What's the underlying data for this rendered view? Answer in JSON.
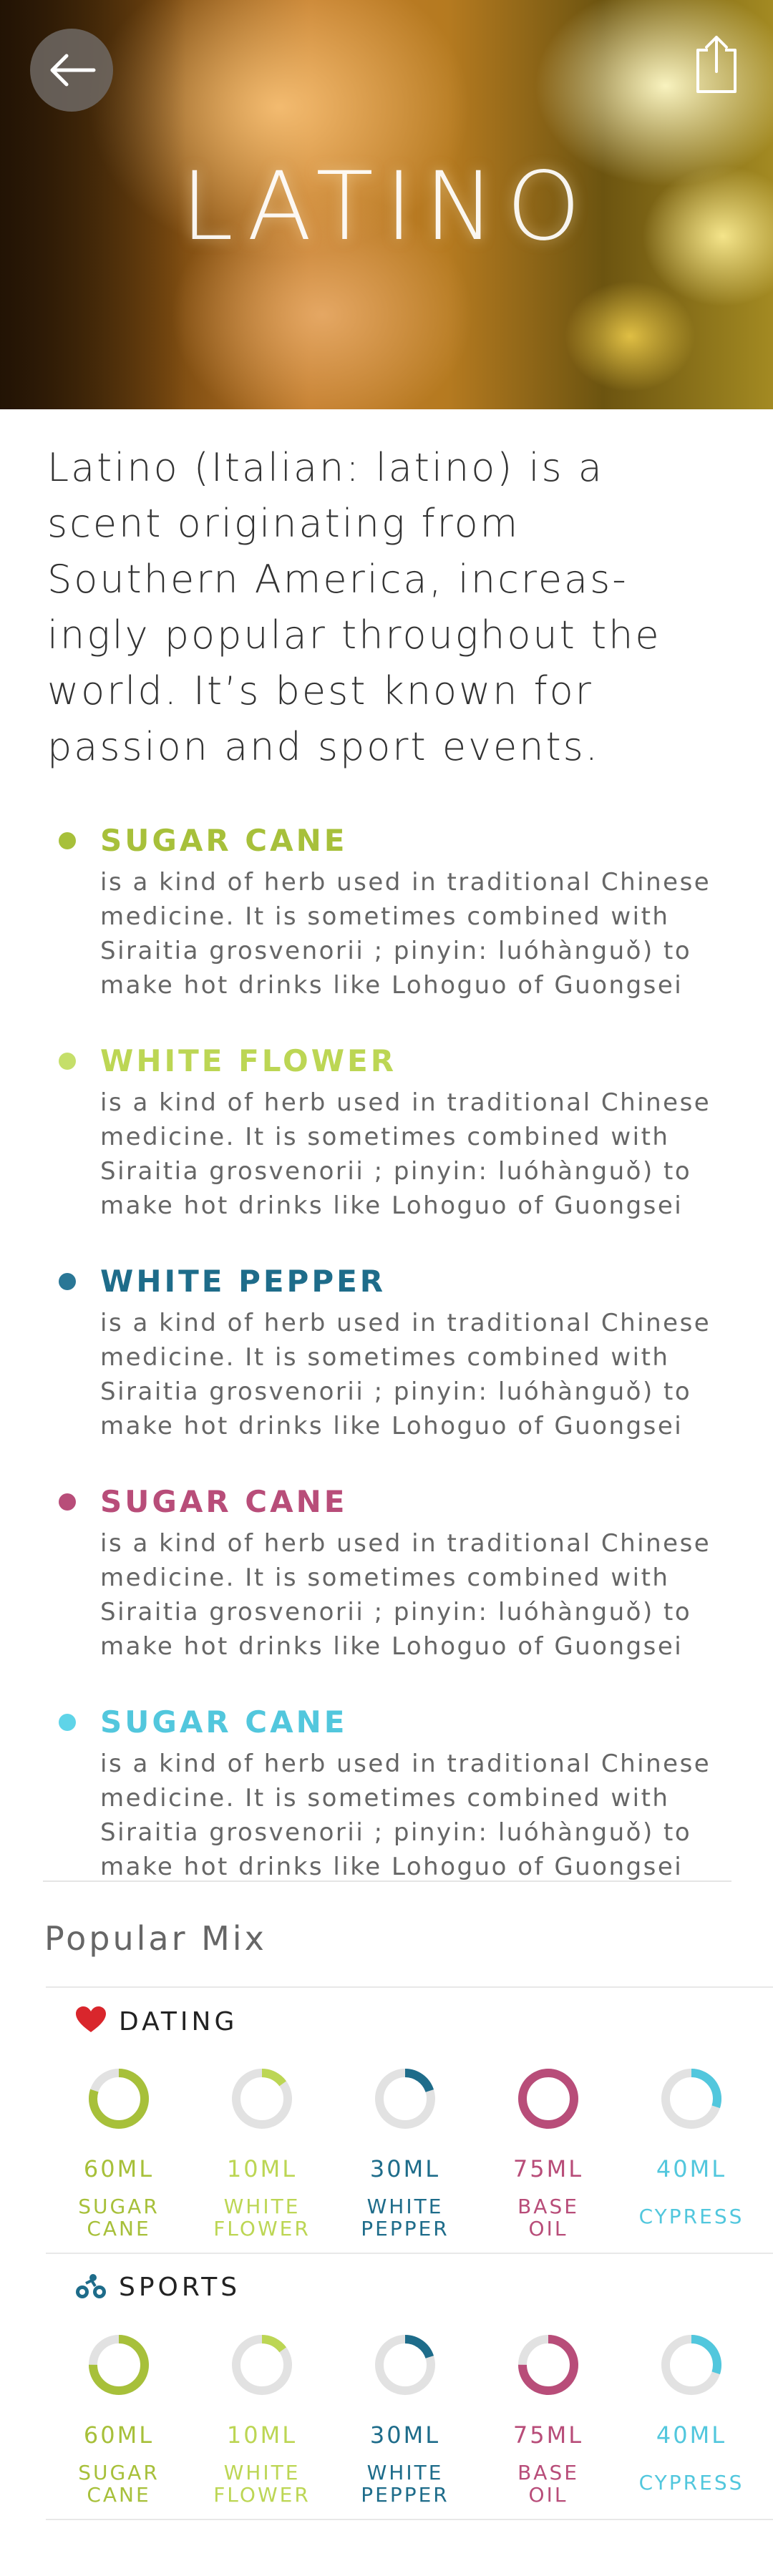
{
  "header": {
    "title": "LATINO",
    "back_icon": "arrow-left-icon",
    "share_icon": "share-icon"
  },
  "intro": {
    "text": "Latino (Italian: latino) is a scent originating from Southern America, increas-ingly popular throughout the world. It’s best known for passion and sport events.",
    "lines": [
      "Latino (Italian: latino) is a",
      "scent originating from",
      "Southern America, increas-",
      "ingly popular throughout the",
      "world. It’s best known for",
      "passion and sport events."
    ]
  },
  "ingredients": [
    {
      "name": "SUGAR CANE",
      "color": "#a7c03a",
      "dot": "#a7c03a",
      "lines": [
        "is a kind of herb used in traditional Chinese",
        "medicine. It is sometimes combined with",
        "Siraitia grosvenorii ; pinyin: luóhànguǒ) to",
        "make hot drinks like Lohoguo of Guongsei"
      ]
    },
    {
      "name": "WHITE FLOWER",
      "color": "#bcd654",
      "dot": "#c5df6a",
      "lines": [
        "is a kind of herb used in traditional Chinese",
        "medicine. It is sometimes combined with",
        "Siraitia grosvenorii ; pinyin: luóhànguǒ) to",
        "make hot drinks like Lohoguo of Guongsei"
      ]
    },
    {
      "name": "WHITE PEPPER",
      "color": "#1e6c8a",
      "dot": "#2a7796",
      "lines": [
        "is a kind of herb used in traditional Chinese",
        "medicine. It is sometimes combined with",
        "Siraitia grosvenorii ; pinyin: luóhànguǒ) to",
        "make hot drinks like Lohoguo of Guongsei"
      ]
    },
    {
      "name": "SUGAR CANE",
      "color": "#b84d79",
      "dot": "#b84d79",
      "lines": [
        "is a kind of herb used in traditional Chinese",
        "medicine. It is sometimes combined with",
        "Siraitia grosvenorii ; pinyin: luóhànguǒ) to",
        "make hot drinks like Lohoguo of Guongsei"
      ]
    },
    {
      "name": "SUGAR CANE",
      "color": "#52c7dd",
      "dot": "#5fd4e8",
      "lines": [
        "is a kind of herb used in traditional Chinese",
        "medicine. It is sometimes combined with",
        "Siraitia grosvenorii ; pinyin: luóhànguǒ) to",
        "make hot drinks like Lohoguo of Guongsei"
      ]
    }
  ],
  "popular_mix": {
    "title": "Popular Mix",
    "mixes": [
      {
        "label": "DATING",
        "icon": "heart-icon",
        "icon_color": "#d9262c",
        "items": [
          {
            "amount": "60ML",
            "lines": [
              "SUGAR",
              "CANE"
            ],
            "color": "#a7c03a",
            "fraction": 0.8
          },
          {
            "amount": "10ML",
            "lines": [
              "WHITE",
              "FLOWER"
            ],
            "color": "#bcd654",
            "fraction": 0.15
          },
          {
            "amount": "30ML",
            "lines": [
              "WHITE",
              "PEPPER"
            ],
            "color": "#1e6c8a",
            "fraction": 0.2
          },
          {
            "amount": "75ML",
            "lines": [
              "BASE",
              "OIL"
            ],
            "color": "#b84d79",
            "fraction": 1.0
          },
          {
            "amount": "40ML",
            "lines": [
              "CYPRESS"
            ],
            "color": "#52c7dd",
            "fraction": 0.3
          }
        ]
      },
      {
        "label": "SPORTS",
        "icon": "bicycle-icon",
        "icon_color": "#1e6c8a",
        "items": [
          {
            "amount": "60ML",
            "lines": [
              "SUGAR",
              "CANE"
            ],
            "color": "#a7c03a",
            "fraction": 0.75
          },
          {
            "amount": "10ML",
            "lines": [
              "WHITE",
              "FLOWER"
            ],
            "color": "#bcd654",
            "fraction": 0.15
          },
          {
            "amount": "30ML",
            "lines": [
              "WHITE",
              "PEPPER"
            ],
            "color": "#1e6c8a",
            "fraction": 0.2
          },
          {
            "amount": "75ML",
            "lines": [
              "BASE",
              "OIL"
            ],
            "color": "#b84d79",
            "fraction": 0.75
          },
          {
            "amount": "40ML",
            "lines": [
              "CYPRESS"
            ],
            "color": "#52c7dd",
            "fraction": 0.3
          }
        ]
      }
    ]
  }
}
